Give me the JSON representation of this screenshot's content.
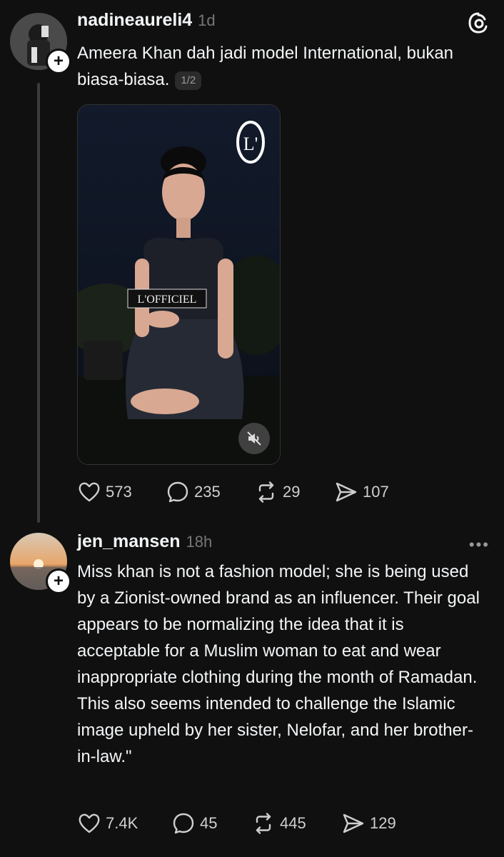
{
  "posts": [
    {
      "username": "nadineaureli4",
      "time": "1d",
      "text": "Ameera Khan dah jadi model International, bukan biasa-biasa.",
      "page_indicator": "1/2",
      "media_brand_logo": "L'",
      "media_tag_text": "L'OFFICIEL",
      "stats": {
        "likes": "573",
        "replies": "235",
        "reposts": "29",
        "shares": "107"
      }
    },
    {
      "username": "jen_mansen",
      "time": "18h",
      "text": "Miss khan is not a fashion model; she is being used by a Zionist-owned brand as an influencer. Their goal appears to be normalizing the idea that it is acceptable for a Muslim woman to eat and wear inappropriate clothing during the month of Ramadan. This also seems intended to challenge the Islamic image upheld by her sister, Nelofar, and her brother-in-law.\"",
      "stats": {
        "likes": "7.4K",
        "replies": "45",
        "reposts": "445",
        "shares": "129"
      }
    }
  ],
  "icons": {
    "threads_logo": "threads-icon",
    "more": "more-icon",
    "follow": "plus-icon",
    "like": "heart-icon",
    "reply": "comment-icon",
    "repost": "repost-icon",
    "share": "send-icon",
    "mute": "muted-speaker-icon"
  },
  "labels": {
    "follow_symbol": "+",
    "more_symbol": "•••"
  },
  "colors": {
    "background": "#101010",
    "text": "#f3f5f7",
    "muted": "#777777"
  }
}
